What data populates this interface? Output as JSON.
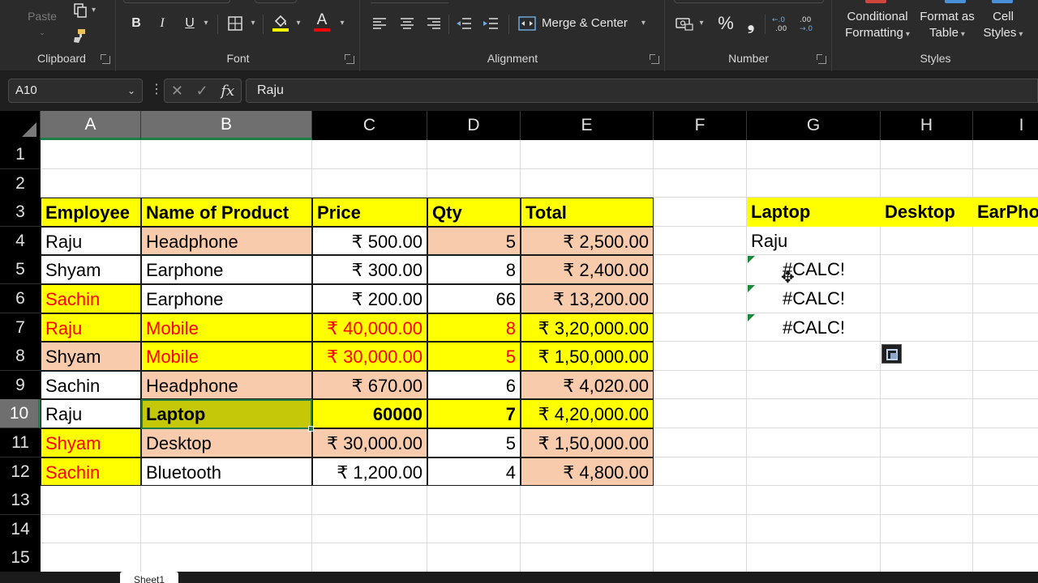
{
  "ribbon": {
    "clipboard": {
      "label": "Clipboard",
      "paste": "Paste"
    },
    "font": {
      "label": "Font",
      "bold": "B",
      "italic": "I",
      "underline": "U",
      "font_color_glyph": "A"
    },
    "alignment": {
      "label": "Alignment",
      "merge_center": "Merge & Center"
    },
    "number": {
      "label": "Number",
      "percent": "%",
      "comma": "❟"
    },
    "styles": {
      "label": "Styles",
      "conditional_1": "Conditional",
      "conditional_2": "Formatting",
      "format_table_1": "Format as",
      "format_table_2": "Table",
      "cell_styles_1": "Cell",
      "cell_styles_2": "Styles"
    }
  },
  "formula_bar": {
    "name_box": "A10",
    "content": "Raju",
    "fx": "fx"
  },
  "sheet": {
    "columns": [
      "A",
      "B",
      "C",
      "D",
      "E",
      "F",
      "G",
      "H",
      "I"
    ],
    "rows": [
      "1",
      "2",
      "3",
      "4",
      "5",
      "6",
      "7",
      "8",
      "9",
      "10",
      "11",
      "12",
      "13",
      "14",
      "15"
    ],
    "selected_cell": "A10",
    "table_headers": [
      "Employee",
      "Name of Product",
      "Price",
      "Qty",
      "Total"
    ],
    "table_rows": [
      [
        "Raju",
        "Headphone",
        "₹ 500.00",
        "5",
        "₹ 2,500.00"
      ],
      [
        "Shyam",
        "Earphone",
        "₹ 300.00",
        "8",
        "₹ 2,400.00"
      ],
      [
        "Sachin",
        "Earphone",
        "₹ 200.00",
        "66",
        "₹ 13,200.00"
      ],
      [
        "Raju",
        "Mobile",
        "₹ 40,000.00",
        "8",
        "₹ 3,20,000.00"
      ],
      [
        "Shyam",
        "Mobile",
        "₹ 30,000.00",
        "5",
        "₹ 1,50,000.00"
      ],
      [
        "Sachin",
        "Headphone",
        "₹ 670.00",
        "6",
        "₹ 4,020.00"
      ],
      [
        "Raju",
        "Laptop",
        "60000",
        "7",
        "₹ 4,20,000.00"
      ],
      [
        "Shyam",
        "Desktop",
        "₹ 30,000.00",
        "5",
        "₹ 1,50,000.00"
      ],
      [
        "Sachin",
        "Bluetooth",
        "₹ 1,200.00",
        "4",
        "₹ 4,800.00"
      ]
    ],
    "side_headers": [
      "Laptop",
      "Desktop",
      "EarPho"
    ],
    "side_values": [
      "Raju",
      "#CALC!",
      "#CALC!",
      "#CALC!"
    ],
    "tab_name": "Sheet1"
  },
  "colors": {
    "header_fill": "#ffff00",
    "peach_fill": "#f8cbad",
    "selected_fill": "#c5c808",
    "red_text": "#ff0000",
    "selection_border": "#1e7e45"
  }
}
